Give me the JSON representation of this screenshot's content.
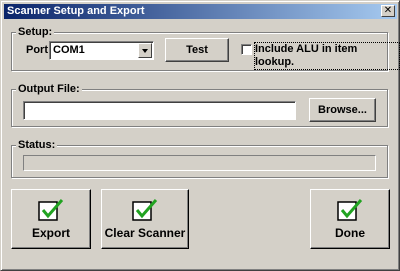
{
  "window": {
    "title": "Scanner Setup and Export",
    "close_glyph": "✕"
  },
  "setup": {
    "group_label": "Setup:",
    "port_label": "Port:",
    "port_value": "COM1",
    "test_label": "Test",
    "alu_checkbox_label": "Include ALU in item lookup.",
    "alu_checked": false
  },
  "output": {
    "group_label": "Output File:",
    "file_value": "",
    "browse_label": "Browse..."
  },
  "status": {
    "group_label": "Status:",
    "value": ""
  },
  "actions": {
    "export_label": "Export",
    "clear_label": "Clear Scanner",
    "done_label": "Done"
  },
  "colors": {
    "check_green": "#21a321",
    "face": "#d4d0c8",
    "title_start": "#0a246a",
    "title_end": "#a6caf0"
  }
}
